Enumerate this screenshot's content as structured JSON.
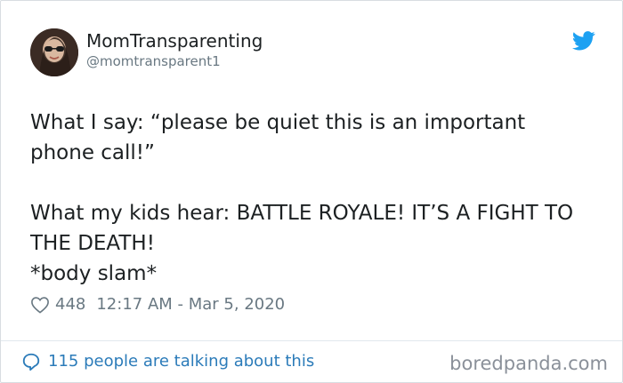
{
  "author": {
    "name": "MomTransparenting",
    "handle": "@momtransparent1"
  },
  "tweet": {
    "lines": [
      "What I say: “please be quiet this is an important phone call!”",
      "What my kids hear: BATTLE ROYALE! IT’S A FIGHT TO THE DEATH!",
      "*body slam*"
    ],
    "likes": "448",
    "timestamp": "12:17 AM - Mar 5, 2020"
  },
  "footer": {
    "discussion_text": "115 people are talking about this",
    "watermark": "boredpanda.com"
  },
  "icons": {
    "brand": "twitter-bird-icon",
    "like": "heart-icon",
    "discussion": "comment-icon"
  },
  "colors": {
    "twitter_blue": "#1da1f2",
    "link_blue": "#2b7bb9",
    "meta_gray": "#697882",
    "text": "#1c2022"
  }
}
